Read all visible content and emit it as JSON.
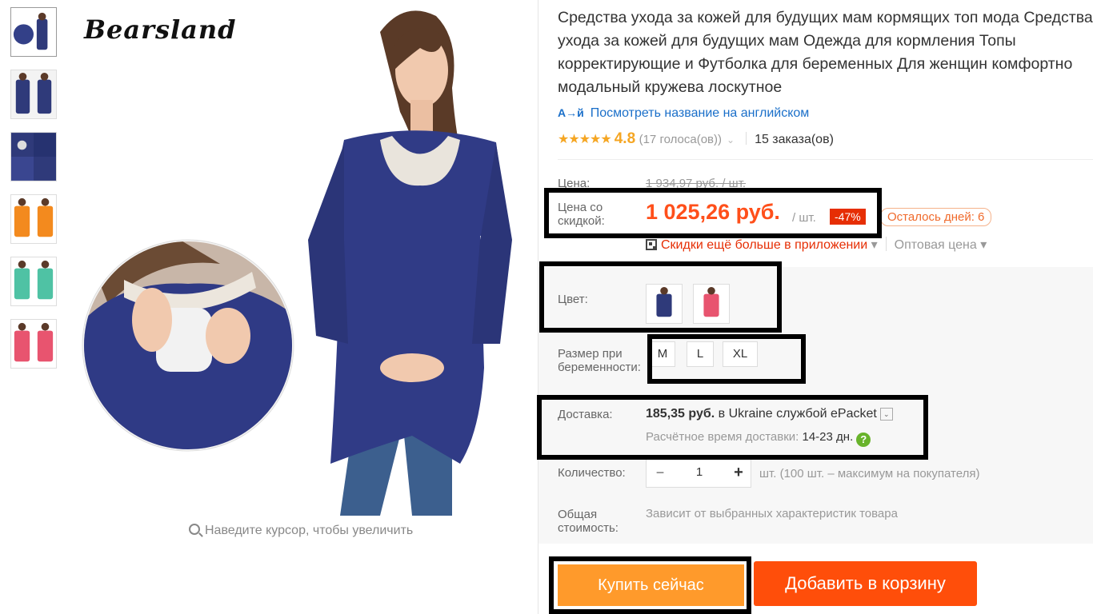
{
  "brand": {
    "logo_text": "Bearsland"
  },
  "gallery": {
    "thumbnails": [
      {
        "icon": "thumb-photo-1"
      },
      {
        "icon": "thumb-photo-2"
      },
      {
        "icon": "thumb-photo-3"
      },
      {
        "icon": "thumb-photo-4"
      },
      {
        "icon": "thumb-photo-5"
      },
      {
        "icon": "thumb-photo-6"
      }
    ],
    "zoom_hint": "Наведите курсор, чтобы увеличить"
  },
  "product": {
    "title": "Средства ухода за кожей для будущих мам кормящих топ мода Средства ухода за кожей для будущих мам Одежда для кормления Топы корректирующие и Футболка для беременных Для женщин комфортно модальный кружева лоскутное",
    "translate_link": "Посмотреть название на английском",
    "translate_icon": "A→й",
    "rating": {
      "stars": "★★★★★",
      "value": "4.8",
      "votes": "(17 голоса(ов))",
      "chevron": "⌄",
      "orders": "15 заказа(ов)"
    }
  },
  "price": {
    "label": "Цена:",
    "old": "1 934,97 руб. / шт.",
    "discount_label": "Цена со скидкой:",
    "discount_price": "1 025,26 руб.",
    "per_unit": "/ шт.",
    "discount_badge": "-47%",
    "days_left": "Осталось дней: 6",
    "app_discount": "Скидки ещё больше в приложении",
    "wholesale": "Оптовая цена",
    "caret": "▾"
  },
  "options": {
    "color_label": "Цвет:",
    "colors": [
      {
        "name": "navy",
        "hex": "#2f3a7a"
      },
      {
        "name": "pink",
        "hex": "#e8546f"
      }
    ],
    "size_label": "Размер при беременности:",
    "sizes": [
      "M",
      "L",
      "XL"
    ]
  },
  "shipping": {
    "label": "Доставка:",
    "price": "185,35 руб.",
    "to": "в Ukraine службой ePacket",
    "dropdown": "⌄",
    "eta_label": "Расчётное время доставки:",
    "eta_days": "14-23 дн.",
    "help": "?"
  },
  "quantity": {
    "label": "Количество:",
    "minus": "−",
    "value": "1",
    "plus": "+",
    "note": "шт. (100 шт. – максимум на покупателя)"
  },
  "total": {
    "label": "Общая стоимость:",
    "value": "Зависит от выбранных характеристик товара"
  },
  "actions": {
    "buy_now": "Купить сейчас",
    "add_to_cart": "Добавить в корзину"
  },
  "colors": {
    "accent": "#ff4f1a",
    "buy": "#ff9a2b",
    "cart": "#ff4e0a",
    "link": "#1a6fc9",
    "star": "#f5a623"
  }
}
